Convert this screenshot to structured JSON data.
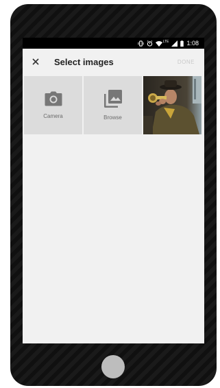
{
  "status_bar": {
    "time": "1:08",
    "network": "LTE"
  },
  "app_bar": {
    "title": "Select images",
    "done_label": "DONE"
  },
  "tiles": [
    {
      "label": "Camera",
      "icon": "camera-icon"
    },
    {
      "label": "Browse",
      "icon": "gallery-icon"
    }
  ],
  "colors": {
    "screen_bg": "#f1f1f1",
    "tile_bg": "#dcdcdc",
    "icon_gray": "#777777",
    "done_disabled": "#c9c9c9"
  }
}
